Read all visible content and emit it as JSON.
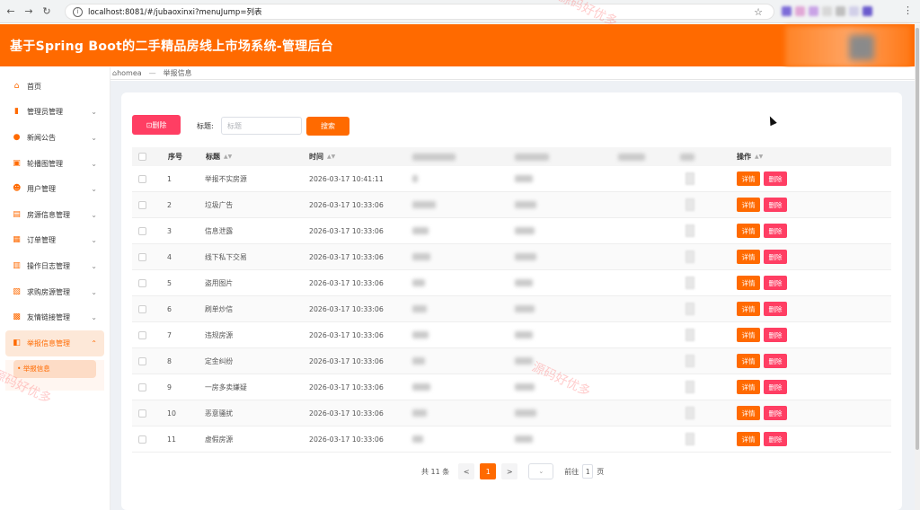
{
  "browser": {
    "url": "localhost:8081/#/jubaoxinxi?menuJump=列表"
  },
  "header": {
    "title": "基于Spring Boot的二手精品房线上市场系统-管理后台"
  },
  "breadcrumb": {
    "home": "homea",
    "separator": "—",
    "current": "举报信息"
  },
  "sidebar": {
    "items": [
      {
        "label": "首页",
        "icon": "home-icon",
        "has_children": false
      },
      {
        "label": "管理员管理",
        "icon": "admin-icon",
        "has_children": true
      },
      {
        "label": "新闻公告",
        "icon": "news-icon",
        "has_children": true
      },
      {
        "label": "轮播图管理",
        "icon": "carousel-icon",
        "has_children": true
      },
      {
        "label": "用户管理",
        "icon": "user-icon",
        "has_children": true
      },
      {
        "label": "房源信息管理",
        "icon": "house-icon",
        "has_children": true
      },
      {
        "label": "订单管理",
        "icon": "order-icon",
        "has_children": true
      },
      {
        "label": "操作日志管理",
        "icon": "log-icon",
        "has_children": true
      },
      {
        "label": "求购房源管理",
        "icon": "cart-icon",
        "has_children": true
      },
      {
        "label": "友情链接管理",
        "icon": "link-icon",
        "has_children": true
      },
      {
        "label": "举报信息管理",
        "icon": "report-icon",
        "has_children": true,
        "active": true
      }
    ],
    "sub_item": "• 举报信息"
  },
  "toolbar": {
    "delete_label": "⊡删除",
    "title_label": "标题:",
    "title_placeholder": "标题",
    "search_label": "搜索"
  },
  "table": {
    "headers": {
      "index": "序号",
      "title": "标题",
      "time": "时间",
      "actions": "操作"
    },
    "rows": [
      {
        "index": "1",
        "title": "举报不实房源",
        "time": "2026-03-17 10:41:11"
      },
      {
        "index": "2",
        "title": "垃圾广告",
        "time": "2026-03-17 10:33:06"
      },
      {
        "index": "3",
        "title": "信息泄露",
        "time": "2026-03-17 10:33:06"
      },
      {
        "index": "4",
        "title": "线下私下交易",
        "time": "2026-03-17 10:33:06"
      },
      {
        "index": "5",
        "title": "盗用图片",
        "time": "2026-03-17 10:33:06"
      },
      {
        "index": "6",
        "title": "刷单炒信",
        "time": "2026-03-17 10:33:06"
      },
      {
        "index": "7",
        "title": "违规房源",
        "time": "2026-03-17 10:33:06"
      },
      {
        "index": "8",
        "title": "定金纠纷",
        "time": "2026-03-17 10:33:06"
      },
      {
        "index": "9",
        "title": "一房多卖嫌疑",
        "time": "2026-03-17 10:33:06"
      },
      {
        "index": "10",
        "title": "恶意骚扰",
        "time": "2026-03-17 10:33:06"
      },
      {
        "index": "11",
        "title": "虚假房源",
        "time": "2026-03-17 10:33:06"
      }
    ],
    "detail_label": "详情",
    "remove_label": "删除"
  },
  "pagination": {
    "total": "共 11 条",
    "prev": "<",
    "current_page": "1",
    "next": ">",
    "size_selector": "⌄",
    "goto_label": "前往",
    "goto_value": "1",
    "page_suffix": "页"
  },
  "watermark": "源码好优多",
  "colors": {
    "accent": "#ff6a00",
    "danger": "#ff3e63"
  }
}
